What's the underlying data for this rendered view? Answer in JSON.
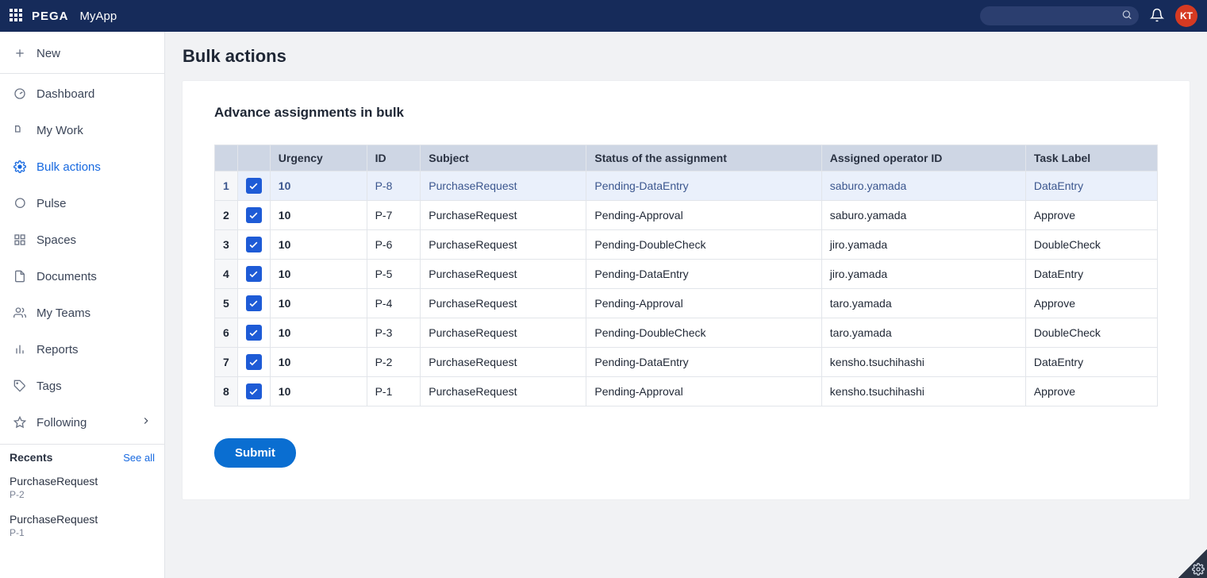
{
  "header": {
    "brand": "PEGA",
    "app_name": "MyApp",
    "search_placeholder": "",
    "avatar_initials": "KT"
  },
  "sidebar": {
    "items": [
      {
        "id": "new",
        "label": "New"
      },
      {
        "id": "dashboard",
        "label": "Dashboard"
      },
      {
        "id": "mywork",
        "label": "My Work"
      },
      {
        "id": "bulk",
        "label": "Bulk actions"
      },
      {
        "id": "pulse",
        "label": "Pulse"
      },
      {
        "id": "spaces",
        "label": "Spaces"
      },
      {
        "id": "documents",
        "label": "Documents"
      },
      {
        "id": "myteams",
        "label": "My Teams"
      },
      {
        "id": "reports",
        "label": "Reports"
      },
      {
        "id": "tags",
        "label": "Tags"
      },
      {
        "id": "following",
        "label": "Following"
      }
    ],
    "recents_header": "Recents",
    "see_all_label": "See all",
    "recents": [
      {
        "title": "PurchaseRequest",
        "sub": "P-2"
      },
      {
        "title": "PurchaseRequest",
        "sub": "P-1"
      }
    ]
  },
  "page": {
    "title": "Bulk actions",
    "card_title": "Advance assignments in bulk",
    "submit_label": "Submit",
    "table": {
      "columns": [
        "",
        "",
        "Urgency",
        "ID",
        "Subject",
        "Status of the assignment",
        "Assigned operator ID",
        "Task Label"
      ],
      "rows": [
        {
          "n": "1",
          "checked": true,
          "urgency": "10",
          "id": "P-8",
          "subject": "PurchaseRequest",
          "status": "Pending-DataEntry",
          "operator": "saburo.yamada",
          "task": "DataEntry"
        },
        {
          "n": "2",
          "checked": true,
          "urgency": "10",
          "id": "P-7",
          "subject": "PurchaseRequest",
          "status": "Pending-Approval",
          "operator": "saburo.yamada",
          "task": "Approve"
        },
        {
          "n": "3",
          "checked": true,
          "urgency": "10",
          "id": "P-6",
          "subject": "PurchaseRequest",
          "status": "Pending-DoubleCheck",
          "operator": "jiro.yamada",
          "task": "DoubleCheck"
        },
        {
          "n": "4",
          "checked": true,
          "urgency": "10",
          "id": "P-5",
          "subject": "PurchaseRequest",
          "status": "Pending-DataEntry",
          "operator": "jiro.yamada",
          "task": "DataEntry"
        },
        {
          "n": "5",
          "checked": true,
          "urgency": "10",
          "id": "P-4",
          "subject": "PurchaseRequest",
          "status": "Pending-Approval",
          "operator": "taro.yamada",
          "task": "Approve"
        },
        {
          "n": "6",
          "checked": true,
          "urgency": "10",
          "id": "P-3",
          "subject": "PurchaseRequest",
          "status": "Pending-DoubleCheck",
          "operator": "taro.yamada",
          "task": "DoubleCheck"
        },
        {
          "n": "7",
          "checked": true,
          "urgency": "10",
          "id": "P-2",
          "subject": "PurchaseRequest",
          "status": "Pending-DataEntry",
          "operator": "kensho.tsuchihashi",
          "task": "DataEntry"
        },
        {
          "n": "8",
          "checked": true,
          "urgency": "10",
          "id": "P-1",
          "subject": "PurchaseRequest",
          "status": "Pending-Approval",
          "operator": "kensho.tsuchihashi",
          "task": "Approve"
        }
      ]
    }
  }
}
